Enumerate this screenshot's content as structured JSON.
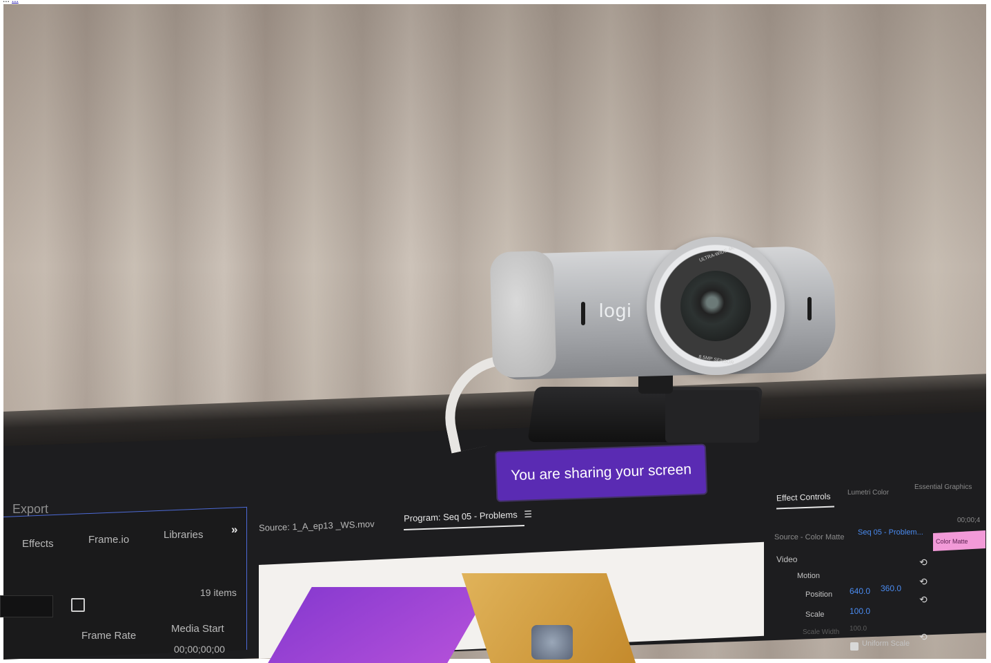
{
  "caption": {
    "prefix": "...",
    "link": "..."
  },
  "banner": {
    "text": "You are sharing your screen"
  },
  "left_panel": {
    "title": "Export",
    "tabs": [
      "Effects",
      "Frame.io",
      "Libraries"
    ],
    "more": "»",
    "items_count": "19 items",
    "columns": [
      "Frame Rate",
      "Media Start"
    ],
    "first_value": "00;00;00;00"
  },
  "monitor_tabs": {
    "source": "Source: 1_A_ep13 _WS.mov",
    "program": "Program: Seq 05 - Problems",
    "menu": "☰"
  },
  "effect_controls": {
    "tabs": [
      "Effect Controls",
      "Lumetri Color",
      "Essential Graphics"
    ],
    "source": "Source - Color Matte",
    "sequence": "Seq 05 - Problem...",
    "section": "Video",
    "group": "Motion",
    "params": [
      {
        "label": "Position",
        "v1": "640.0",
        "v2": "360.0"
      },
      {
        "label": "Scale",
        "v1": "100.0",
        "v2": ""
      },
      {
        "label": "Scale Width",
        "v1": "100.0",
        "v2": ""
      }
    ],
    "uniform": "Uniform Scale",
    "timecode": "00;00;4",
    "clip_label": "Color Matte"
  },
  "webcam": {
    "logo": "logi",
    "lens_top": "ULTRA-WIDE 4K",
    "lens_bottom": "8.5MP SENSOR"
  },
  "colors": {
    "banner": "#5a2bb3",
    "panel_border": "#4d6bd8",
    "accent_blue": "#4a8bf0",
    "clip_pink": "#f29ad8"
  }
}
